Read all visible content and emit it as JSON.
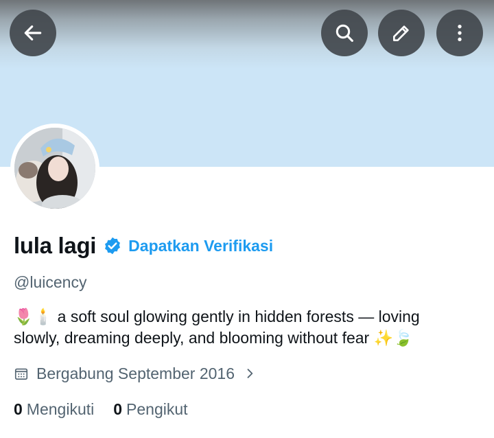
{
  "header": {
    "back_icon": "arrow-left-icon",
    "search_icon": "search-icon",
    "edit_icon": "pencil-icon",
    "more_icon": "more-vertical-icon",
    "banner_color": "#cce5f7"
  },
  "profile": {
    "display_name": "lula lagi",
    "verified_badge": "verified-icon",
    "verify_link": "Dapatkan Verifikasi",
    "handle": "@luicency",
    "bio": "🌷🕯️ a soft soul glowing gently in hidden forests — loving slowly, dreaming deeply, and blooming without fear ✨🍃",
    "joined": "Bergabung September 2016",
    "following_count": "0",
    "following_label": "Mengikuti",
    "followers_count": "0",
    "followers_label": "Pengikut"
  },
  "colors": {
    "accent": "#1d9bf0",
    "secondary_text": "#536471",
    "primary_text": "#0f1419"
  }
}
